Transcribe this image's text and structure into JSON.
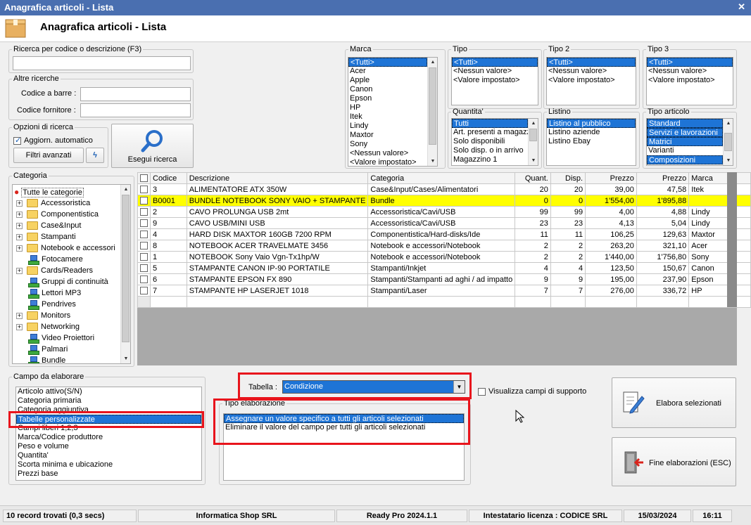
{
  "window": {
    "title": "Anagrafica articoli  - Lista",
    "header_title": "Anagrafica articoli  - Lista"
  },
  "search": {
    "group_label": "Ricerca per codice o descrizione (F3)",
    "value": "",
    "altre_label": "Altre ricerche",
    "barcode_label": "Codice a barre :",
    "supplier_label": "Codice fornitore :",
    "options_label": "Opzioni di ricerca",
    "auto_update_label": "Aggiorn. automatico",
    "advanced_filters_label": "Filtri avanzati",
    "run_label": "Esegui ricerca"
  },
  "filters": {
    "marca": {
      "label": "Marca",
      "items": [
        "<Tutti>",
        "Acer",
        "Apple",
        "Canon",
        "Epson",
        "HP",
        "Itek",
        "Lindy",
        "Maxtor",
        "Sony",
        "<Nessun valore>",
        "<Valore impostato>"
      ]
    },
    "tipo": {
      "label": "Tipo",
      "items": [
        "<Tutti>",
        "<Nessun valore>",
        "<Valore impostato>"
      ]
    },
    "tipo2": {
      "label": "Tipo 2",
      "items": [
        "<Tutti>",
        "<Nessun valore>",
        "<Valore impostato>"
      ]
    },
    "tipo3": {
      "label": "Tipo 3",
      "items": [
        "<Tutti>",
        "<Nessun valore>",
        "<Valore impostato>"
      ]
    },
    "quantita": {
      "label": "Quantita'",
      "items": [
        "Tutti",
        "Art. presenti a magazzino",
        "Solo disponibili",
        "Solo disp. o in arrivo",
        "Magazzino 1"
      ]
    },
    "listino": {
      "label": "Listino",
      "items": [
        "Listino al pubblico",
        "Listino aziende",
        "Listino Ebay"
      ]
    },
    "tipo_articolo": {
      "label": "Tipo articolo",
      "items": [
        "Standard",
        "Servizi e lavorazioni",
        "Matrici",
        "Varianti",
        "Composizioni"
      ]
    }
  },
  "categories": {
    "label": "Categoria",
    "root": "Tutte le categorie",
    "items": [
      {
        "label": "Accessoristica",
        "kind": "folder",
        "expandable": true
      },
      {
        "label": "Componentistica",
        "kind": "folder",
        "expandable": true
      },
      {
        "label": "Case&Input",
        "kind": "folder",
        "expandable": true
      },
      {
        "label": "Stampanti",
        "kind": "folder",
        "expandable": true
      },
      {
        "label": "Notebook e accessori",
        "kind": "folder",
        "expandable": true
      },
      {
        "label": "Fotocamere",
        "kind": "net",
        "expandable": false
      },
      {
        "label": "Cards/Readers",
        "kind": "folder",
        "expandable": true
      },
      {
        "label": "Gruppi di continuità",
        "kind": "net",
        "expandable": false
      },
      {
        "label": "Lettori MP3",
        "kind": "net",
        "expandable": false
      },
      {
        "label": "Pendrives",
        "kind": "net",
        "expandable": false
      },
      {
        "label": "Monitors",
        "kind": "folder",
        "expandable": true
      },
      {
        "label": "Networking",
        "kind": "folder",
        "expandable": true
      },
      {
        "label": "Video Proiettori",
        "kind": "net",
        "expandable": false
      },
      {
        "label": "Palmari",
        "kind": "net",
        "expandable": false
      },
      {
        "label": "Bundle",
        "kind": "net",
        "expandable": false
      }
    ]
  },
  "grid": {
    "columns": [
      "Codice",
      "Descrizione",
      "Categoria",
      "Quant.",
      "Disp.",
      "Prezzo",
      "Prezzo",
      "Marca"
    ],
    "rows": [
      {
        "codice": "3",
        "descrizione": "ALIMENTATORE ATX 350W",
        "categoria": "Case&Input/Cases/Alimentatori",
        "quant": "20",
        "disp": "20",
        "prezzo1": "39,00",
        "prezzo2": "47,58",
        "marca": "Itek",
        "highlight": false
      },
      {
        "codice": "B0001",
        "descrizione": "BUNDLE NOTEBOOK SONY VAIO + STAMPANTE",
        "categoria": "Bundle",
        "quant": "0",
        "disp": "0",
        "prezzo1": "1'554,00",
        "prezzo2": "1'895,88",
        "marca": "",
        "highlight": true
      },
      {
        "codice": "2",
        "descrizione": "CAVO PROLUNGA USB 2mt",
        "categoria": "Accessoristica/Cavi/USB",
        "quant": "99",
        "disp": "99",
        "prezzo1": "4,00",
        "prezzo2": "4,88",
        "marca": "Lindy",
        "highlight": false
      },
      {
        "codice": "9",
        "descrizione": "CAVO USB/MINI USB",
        "categoria": "Accessoristica/Cavi/USB",
        "quant": "23",
        "disp": "23",
        "prezzo1": "4,13",
        "prezzo2": "5,04",
        "marca": "Lindy",
        "highlight": false
      },
      {
        "codice": "4",
        "descrizione": "HARD DISK MAXTOR 160GB 7200 RPM",
        "categoria": "Componentistica/Hard-disks/Ide",
        "quant": "11",
        "disp": "11",
        "prezzo1": "106,25",
        "prezzo2": "129,63",
        "marca": "Maxtor",
        "highlight": false
      },
      {
        "codice": "8",
        "descrizione": "NOTEBOOK ACER TRAVELMATE 3456",
        "categoria": "Notebook e accessori/Notebook",
        "quant": "2",
        "disp": "2",
        "prezzo1": "263,20",
        "prezzo2": "321,10",
        "marca": "Acer",
        "highlight": false
      },
      {
        "codice": "1",
        "descrizione": "NOTEBOOK Sony Vaio Vgn-Tx1hp/W",
        "categoria": "Notebook e accessori/Notebook",
        "quant": "2",
        "disp": "2",
        "prezzo1": "1'440,00",
        "prezzo2": "1'756,80",
        "marca": "Sony",
        "highlight": false
      },
      {
        "codice": "5",
        "descrizione": "STAMPANTE CANON IP-90 PORTATILE",
        "categoria": "Stampanti/Inkjet",
        "quant": "4",
        "disp": "4",
        "prezzo1": "123,50",
        "prezzo2": "150,67",
        "marca": "Canon",
        "highlight": false
      },
      {
        "codice": "6",
        "descrizione": "STAMPANTE EPSON FX 890",
        "categoria": "Stampanti/Stampanti ad aghi / ad impatto",
        "quant": "9",
        "disp": "9",
        "prezzo1": "195,00",
        "prezzo2": "237,90",
        "marca": "Epson",
        "highlight": false
      },
      {
        "codice": "7",
        "descrizione": "STAMPANTE HP LASERJET 1018",
        "categoria": "Stampanti/Laser",
        "quant": "7",
        "disp": "7",
        "prezzo1": "276,00",
        "prezzo2": "336,72",
        "marca": "HP",
        "highlight": false
      }
    ]
  },
  "campo": {
    "label": "Campo da elaborare",
    "items": [
      "Articolo attivo(S/N)",
      "Categoria primaria",
      "Categoria aggiuntiva",
      "Tabelle personalizzate",
      "Campi liberi 1,2,3",
      "Marca/Codice produttore",
      "Peso e volume",
      "Quantita'",
      "Scorta minima e ubicazione",
      "Prezzi base"
    ]
  },
  "tabella": {
    "label": "Tabella :",
    "value": "Condizione"
  },
  "support_fields_label": "Visualizza campi di supporto",
  "tipo_elaborazione": {
    "label": "Tipo elaborazione",
    "items": [
      "Assegnare un valore specifico a tutti gli articoli selezionati",
      "Eliminare il valore del campo per tutti gli articoli selezionati"
    ]
  },
  "actions": {
    "process_label": "Elabora selezionati",
    "end_label": "Fine elaborazioni (ESC)"
  },
  "status": {
    "records": "10 record trovati (0,3 secs)",
    "company": "Informatica Shop SRL",
    "app": "Ready Pro 2024.1.1",
    "license": "Intestatario licenza : CODICE SRL",
    "date": "15/03/2024",
    "time": "16:11"
  },
  "colors": {
    "title_bar": "#4a6fb0",
    "selection": "#1e74d6",
    "highlight_row": "#ffff00",
    "annotation": "#e8141c"
  }
}
